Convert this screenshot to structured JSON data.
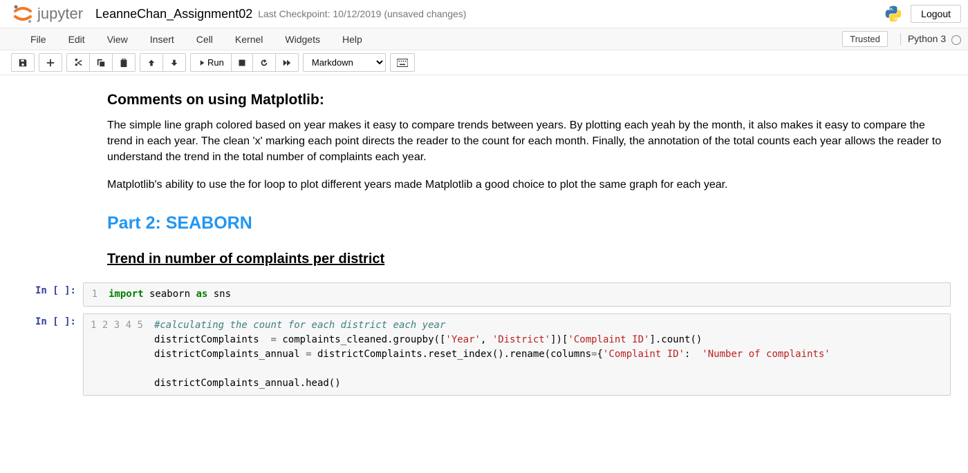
{
  "header": {
    "logo_text": "jupyter",
    "notebook_name": "LeanneChan_Assignment02",
    "checkpoint": "Last Checkpoint: 10/12/2019  (unsaved changes)",
    "logout": "Logout"
  },
  "menubar": {
    "items": [
      "File",
      "Edit",
      "View",
      "Insert",
      "Cell",
      "Kernel",
      "Widgets",
      "Help"
    ],
    "trusted": "Trusted",
    "kernel": "Python 3"
  },
  "toolbar": {
    "run_label": "Run",
    "celltype": "Markdown"
  },
  "content": {
    "h3_1": "Comments on using Matplotlib:",
    "p1": "The simple line graph colored based on year makes it easy to compare trends between years. By plotting each yeah by the month, it also makes it easy to compare the trend in each year. The clean 'x' marking each point directs the reader to the count for each month. Finally, the annotation of the total counts each year allows the reader to understand the trend in the total number of complaints each year.",
    "p2": "Matplotlib's ability to use the for loop to plot different years made Matplotlib a good choice to plot the same graph for each year.",
    "h2_1": "Part 2: SEABORN",
    "h3_2": "Trend in number of complaints per district"
  },
  "cells": {
    "prompt1": "In [ ]:",
    "prompt2": "In [ ]:",
    "code1": {
      "lines": [
        "1"
      ],
      "tokens": [
        {
          "t": "import",
          "c": "kw"
        },
        {
          "t": " seaborn ",
          "c": "nm"
        },
        {
          "t": "as",
          "c": "kw"
        },
        {
          "t": " sns",
          "c": "nm"
        }
      ]
    },
    "code2": {
      "lines": [
        "1",
        "2",
        "3",
        "4",
        "5"
      ],
      "l1": "#calculating the count for each district each year",
      "l2a": "districtComplaints  ",
      "l2b": "=",
      "l2c": " complaints_cleaned.groupby([",
      "l2d": "'Year'",
      "l2e": ", ",
      "l2f": "'District'",
      "l2g": "])[",
      "l2h": "'Complaint ID'",
      "l2i": "].count()",
      "l3a": "districtComplaints_annual ",
      "l3b": "=",
      "l3c": " districtComplaints.reset_index().rename(columns",
      "l3d": "=",
      "l3e": "{",
      "l3f": "'Complaint ID'",
      "l3g": ":  ",
      "l3h": "'Number of complaints'",
      "l5": "districtComplaints_annual.head()"
    }
  }
}
